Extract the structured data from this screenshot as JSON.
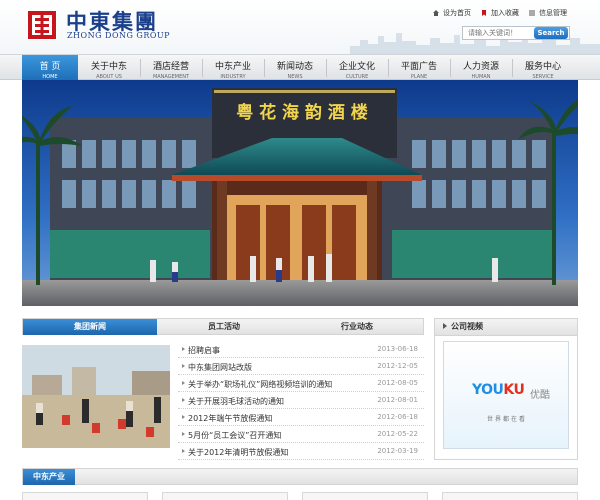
{
  "brand": {
    "name_cn": "中東集團",
    "name_en": "ZHONG DONG GROUP"
  },
  "top_links": [
    {
      "label": "设为首页",
      "icon": "home-icon"
    },
    {
      "label": "加入收藏",
      "icon": "bookmark-icon"
    },
    {
      "label": "信息管理",
      "icon": "manage-icon"
    }
  ],
  "search": {
    "placeholder": "请输入关键词！",
    "button_label": "Search"
  },
  "nav": [
    {
      "label": "首  页",
      "sub": "HOME",
      "active": true
    },
    {
      "label": "关于中东",
      "sub": "ABOUT US"
    },
    {
      "label": "酒店经营",
      "sub": "MANAGEMENT"
    },
    {
      "label": "中东产业",
      "sub": "INDUSTRY"
    },
    {
      "label": "新闻动态",
      "sub": "NEWS"
    },
    {
      "label": "企业文化",
      "sub": "CULTURE"
    },
    {
      "label": "平面广告",
      "sub": "PLANE"
    },
    {
      "label": "人力资源",
      "sub": "HUMAN"
    },
    {
      "label": "服务中心",
      "sub": "SERVICE"
    }
  ],
  "banner": {
    "sign_text": "粤 花 海 韵 酒 楼"
  },
  "news": {
    "tabs": [
      "集团新闻",
      "员工活动",
      "行业动态"
    ],
    "items": [
      {
        "title": "招聘启事",
        "date": "2013-06-18"
      },
      {
        "title": "中东集团网站改版",
        "date": "2012-12-05"
      },
      {
        "title": "关于举办“职场礼仪”网络视频培训的通知",
        "date": "2012-08-05"
      },
      {
        "title": "关于开展羽毛球活动的通知",
        "date": "2012-08-01"
      },
      {
        "title": "2012年端午节放假通知",
        "date": "2012-06-18"
      },
      {
        "title": "5月份“员工会议”召开通知",
        "date": "2012-05-22"
      },
      {
        "title": "关于2012年清明节放假通知",
        "date": "2012-03-19"
      }
    ]
  },
  "video": {
    "title": "公司视频",
    "logo_a": "YOU",
    "logo_b": "KU",
    "logo_cn": "优酷",
    "slogan": "世界都在看"
  },
  "industry": {
    "title": "中东产业"
  },
  "colors": {
    "brand_blue": "#1b3f8b",
    "nav_active": "#1f6fb9",
    "logo_red": "#c4161c"
  }
}
